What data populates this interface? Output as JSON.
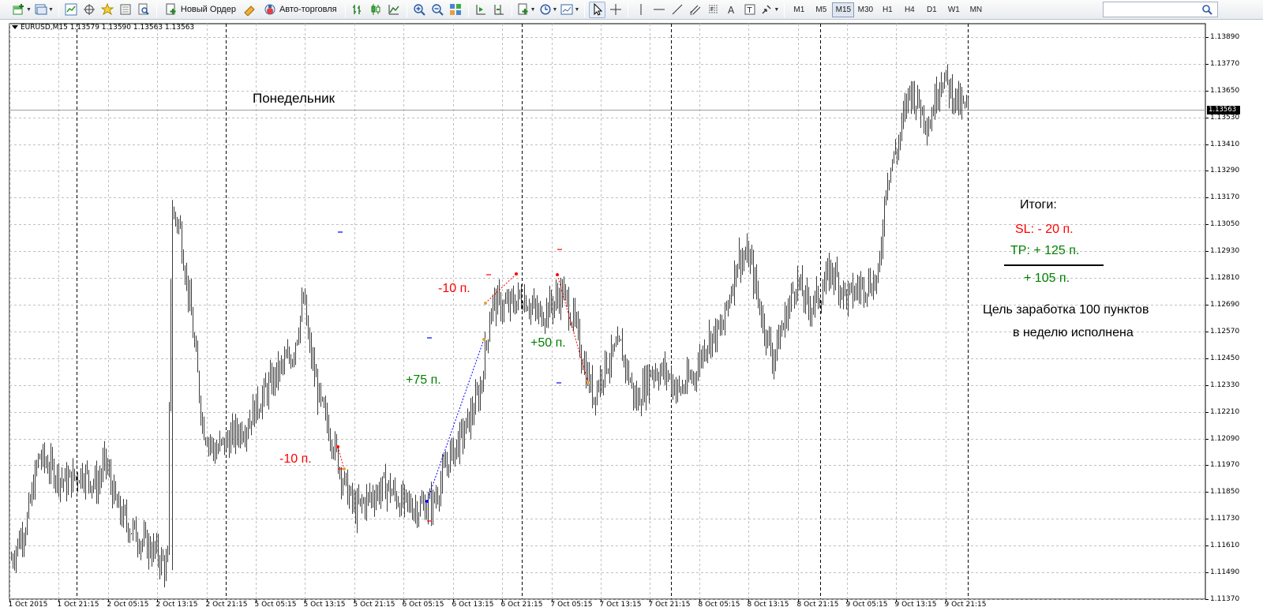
{
  "toolbar": {
    "new_order_label": "Новый Ордер",
    "autotrade_label": "Авто-торговля",
    "timeframes": [
      "M1",
      "M5",
      "M15",
      "M30",
      "H1",
      "H4",
      "D1",
      "W1",
      "MN"
    ],
    "active_timeframe": "M15"
  },
  "chart": {
    "symbol_info": "EURUSD,M15  1.13579 1.13590 1.13563 1.13563",
    "current_price": "1.13563",
    "colors": {
      "bars": "#3c3c3c",
      "grid": "#c0c0c0",
      "red": "#ff0000",
      "green": "#008000",
      "blue": "#0000ff",
      "orange": "#e6a23c"
    }
  },
  "annotations": {
    "monday": "Понедельник",
    "trade1": "-10 п.",
    "trade2": "+75 п.",
    "trade3": "-10 п.",
    "trade4": "+50 п.",
    "summary_title": "Итоги:",
    "sl": "SL: - 20 п.",
    "tp": "TP: + 125 п.",
    "total": "+ 105 п.",
    "goal_line1": "Цель заработка 100 пунктов",
    "goal_line2": "в неделю исполнена"
  },
  "chart_data": {
    "type": "candlestick",
    "symbol": "EURUSD",
    "timeframe": "M15",
    "y_ticks": [
      "1.13890",
      "1.13770",
      "1.13650",
      "1.13530",
      "1.13410",
      "1.13290",
      "1.13170",
      "1.13050",
      "1.12930",
      "1.12810",
      "1.12690",
      "1.12570",
      "1.12450",
      "1.12330",
      "1.12210",
      "1.12090",
      "1.11970",
      "1.11850",
      "1.11730",
      "1.11610",
      "1.11490",
      "1.11370"
    ],
    "ylim": [
      1.1137,
      1.1395
    ],
    "x_ticks": [
      "1 Oct 2015",
      "1 Oct 21:15",
      "2 Oct 05:15",
      "2 Oct 13:15",
      "2 Oct 21:15",
      "5 Oct 05:15",
      "5 Oct 13:15",
      "5 Oct 21:15",
      "6 Oct 05:15",
      "6 Oct 13:15",
      "6 Oct 21:15",
      "7 Oct 05:15",
      "7 Oct 13:15",
      "7 Oct 21:15",
      "8 Oct 05:15",
      "8 Oct 13:15",
      "8 Oct 21:15",
      "9 Oct 05:15",
      "9 Oct 13:15",
      "9 Oct 21:15"
    ],
    "grid": true,
    "path": [
      [
        0,
        1.1155
      ],
      [
        0.02,
        1.1172
      ],
      [
        0.035,
        1.1201
      ],
      [
        0.05,
        1.1196
      ],
      [
        0.07,
        1.1189
      ],
      [
        0.09,
        1.1194
      ],
      [
        0.11,
        1.1188
      ],
      [
        0.12,
        1.1199
      ],
      [
        0.135,
        1.1178
      ],
      [
        0.15,
        1.117
      ],
      [
        0.17,
        1.1162
      ],
      [
        0.185,
        1.1158
      ],
      [
        0.2,
        1.115
      ],
      [
        0.205,
        1.131
      ],
      [
        0.215,
        1.1305
      ],
      [
        0.23,
        1.1265
      ],
      [
        0.245,
        1.1215
      ],
      [
        0.26,
        1.1203
      ],
      [
        0.28,
        1.1209
      ],
      [
        0.3,
        1.1215
      ],
      [
        0.32,
        1.1227
      ],
      [
        0.34,
        1.1238
      ],
      [
        0.36,
        1.1247
      ],
      [
        0.375,
        1.1272
      ],
      [
        0.38,
        1.1253
      ],
      [
        0.395,
        1.1225
      ],
      [
        0.41,
        1.121
      ],
      [
        0.425,
        1.119
      ],
      [
        0.44,
        1.1177
      ],
      [
        0.46,
        1.1183
      ],
      [
        0.48,
        1.1188
      ],
      [
        0.5,
        1.118
      ],
      [
        0.52,
        1.1178
      ],
      [
        0.54,
        1.118
      ],
      [
        0.56,
        1.12
      ],
      [
        0.58,
        1.1212
      ],
      [
        0.6,
        1.123
      ],
      [
        0.615,
        1.127
      ],
      [
        0.635,
        1.1268
      ],
      [
        0.655,
        1.1273
      ],
      [
        0.675,
        1.1264
      ],
      [
        0.695,
        1.127
      ],
      [
        0.705,
        1.1275
      ],
      [
        0.72,
        1.1262
      ],
      [
        0.735,
        1.124
      ],
      [
        0.745,
        1.1228
      ],
      [
        0.76,
        1.1242
      ],
      [
        0.78,
        1.125
      ],
      [
        0.8,
        1.1225
      ],
      [
        0.82,
        1.124
      ],
      [
        0.84,
        1.1238
      ],
      [
        0.855,
        1.123
      ],
      [
        0.875,
        1.1238
      ],
      [
        0.89,
        1.1253
      ],
      [
        0.91,
        1.1258
      ],
      [
        0.93,
        1.129
      ],
      [
        0.945,
        1.129
      ],
      [
        0.96,
        1.1265
      ],
      [
        0.975,
        1.1245
      ],
      [
        0.99,
        1.1262
      ],
      [
        1.005,
        1.128
      ],
      [
        1.02,
        1.1268
      ],
      [
        1.035,
        1.1273
      ],
      [
        1.05,
        1.1285
      ],
      [
        1.07,
        1.1272
      ],
      [
        1.09,
        1.1278
      ],
      [
        1.11,
        1.128
      ],
      [
        1.12,
        1.1325
      ],
      [
        1.135,
        1.134
      ],
      [
        1.15,
        1.1366
      ],
      [
        1.165,
        1.1357
      ],
      [
        1.175,
        1.135
      ],
      [
        1.19,
        1.1372
      ],
      [
        1.205,
        1.1364
      ],
      [
        1.215,
        1.1358
      ],
      [
        1.225,
        1.1356
      ]
    ]
  }
}
